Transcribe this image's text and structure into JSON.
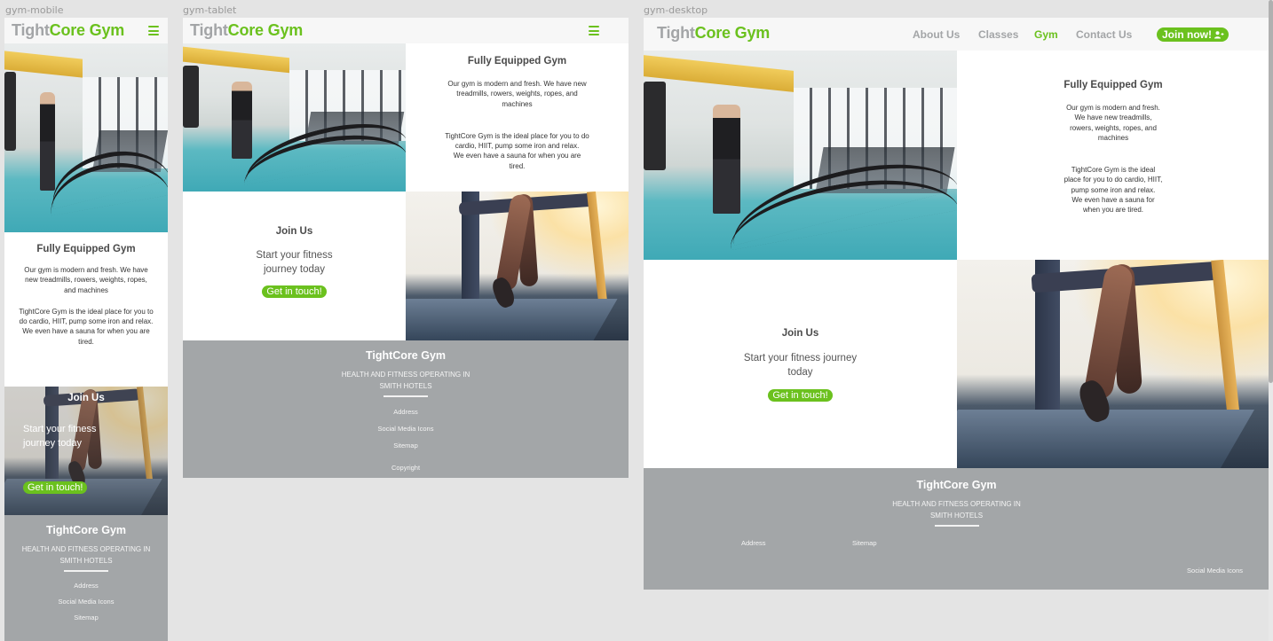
{
  "artboards": {
    "mobile": {
      "label": "gym-mobile"
    },
    "tablet": {
      "label": "gym-tablet"
    },
    "desktop": {
      "label": "gym-desktop"
    }
  },
  "brand": {
    "part1": "Tight",
    "part2": "Core Gym"
  },
  "colors": {
    "accent": "#6bc11e",
    "footer_bg": "#a3a6a8",
    "navbar_bg": "#f7f7f7",
    "logo_grey": "#a3a5a7"
  },
  "nav": {
    "items": [
      {
        "label": "About Us",
        "active": false
      },
      {
        "label": "Classes",
        "active": false
      },
      {
        "label": "Gym",
        "active": true
      },
      {
        "label": "Contact Us",
        "active": false
      }
    ],
    "cta_label": "Join now!",
    "cta_icon": "user-plus-icon",
    "menu_icon": "hamburger-menu-icon"
  },
  "gym_section": {
    "title": "Fully Equipped Gym",
    "para1": "Our gym is modern and fresh. We have new treadmills, rowers, weights, ropes, and machines",
    "para2a": "TightCore Gym is the ideal place for you to do cardio, HIIT, pump some iron and relax.",
    "para2b": "We even have a sauna for when you are tired.",
    "image_alt": "Man training with battle ropes in gym"
  },
  "join_section": {
    "title": "Join Us",
    "tagline": "Start your fitness journey today",
    "button_label": "Get in touch!",
    "image_alt": "Runner legs on treadmill"
  },
  "footer": {
    "title": "TightCore Gym",
    "subtitle": "HEALTH AND FITNESS OPERATING IN SMITH HOTELS",
    "links": {
      "address": "Address",
      "social": "Social Media Icons",
      "sitemap": "Sitemap",
      "copyright": "Copyright"
    }
  }
}
